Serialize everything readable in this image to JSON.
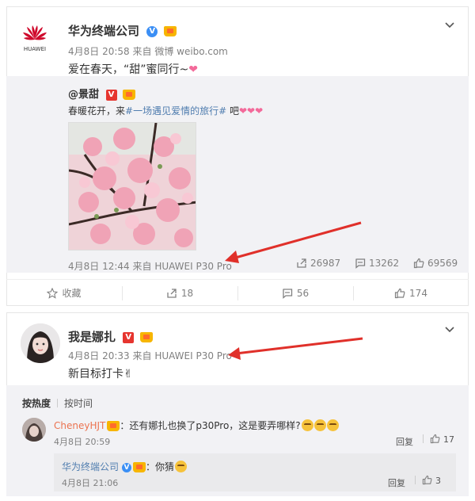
{
  "post1": {
    "author": "华为终端公司",
    "time": "4月8日 20:58",
    "source": "来自 微博 weibo.com",
    "text": "爱在春天，“甜”蜜同行~",
    "logo_text": "HUAWEI"
  },
  "repost": {
    "author": "@景甜",
    "text_pre": "春暖花开，来",
    "hashtag": "#一场遇见爱情的旅行#",
    "text_post": " 吧",
    "time": "4月8日 12:44",
    "source": "来自 HUAWEI P30 Pro",
    "forwards": "26987",
    "comments": "13262",
    "likes": "69569"
  },
  "actions": {
    "favorite": "收藏",
    "forward": "18",
    "comment": "56",
    "like": "174"
  },
  "post2": {
    "author": "我是娜扎",
    "time": "4月8日 20:33",
    "source": "来自 HUAWEI P30 Pro",
    "text": "新目标打卡✌"
  },
  "comment_tabs": {
    "hot": "按热度",
    "time": "按时间"
  },
  "comment1": {
    "user": "CheneyHJT",
    "text": "：还有娜扎也换了p30Pro，这是要弄哪样?",
    "time": "4月8日 20:59",
    "reply_label": "回复",
    "likes": "17"
  },
  "reply1": {
    "user": "华为终端公司",
    "text": "：你猜",
    "time": "4月8日 21:06",
    "reply_label": "回复",
    "likes": "3"
  },
  "colors": {
    "accent_orange": "#eb7350",
    "link_blue": "#507daf",
    "arrow_red": "#e0302a"
  }
}
